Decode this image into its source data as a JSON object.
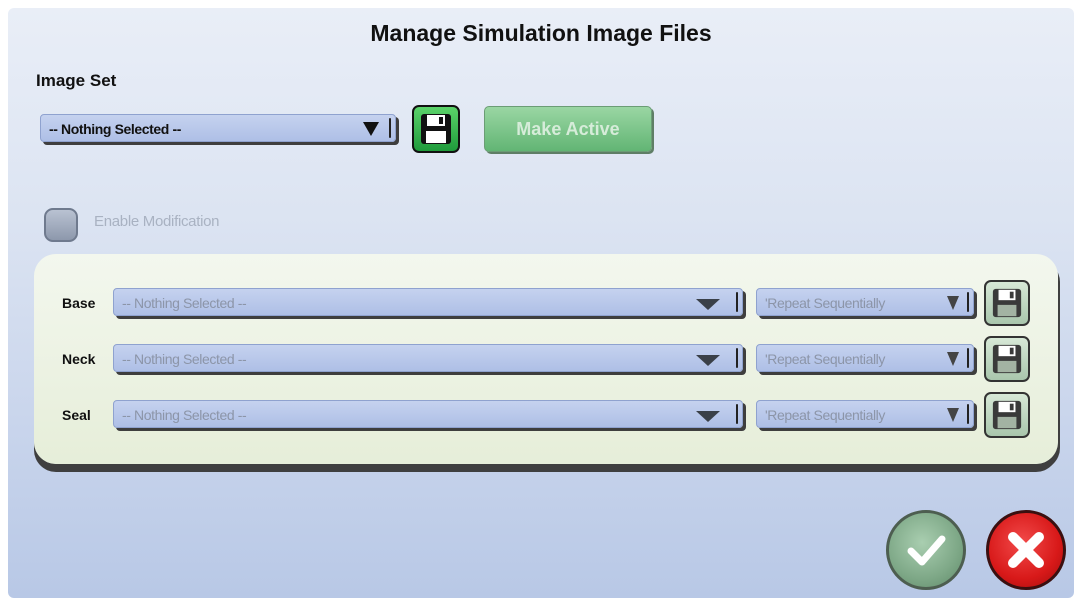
{
  "window": {
    "title": "Manage Simulation Image Files"
  },
  "image_set": {
    "label": "Image Set",
    "selected": "-- Nothing Selected --",
    "make_active_label": "Make Active"
  },
  "modification": {
    "label": "Enable Modification",
    "checked": false
  },
  "rows": [
    {
      "label": "Base",
      "selected": "-- Nothing Selected --",
      "mode": "'Repeat Sequentially"
    },
    {
      "label": "Neck",
      "selected": "-- Nothing Selected --",
      "mode": "'Repeat Sequentially"
    },
    {
      "label": "Seal",
      "selected": "-- Nothing Selected --",
      "mode": "'Repeat Sequentially"
    }
  ],
  "icons": {
    "save": "floppy-disk-icon",
    "dropdown": "triangle-down-icon",
    "ok": "checkmark-icon",
    "cancel": "x-icon"
  },
  "colors": {
    "accent_green": "#1f9b3b",
    "cancel_red": "#d81919",
    "combo_blue": "#aebfe6"
  }
}
